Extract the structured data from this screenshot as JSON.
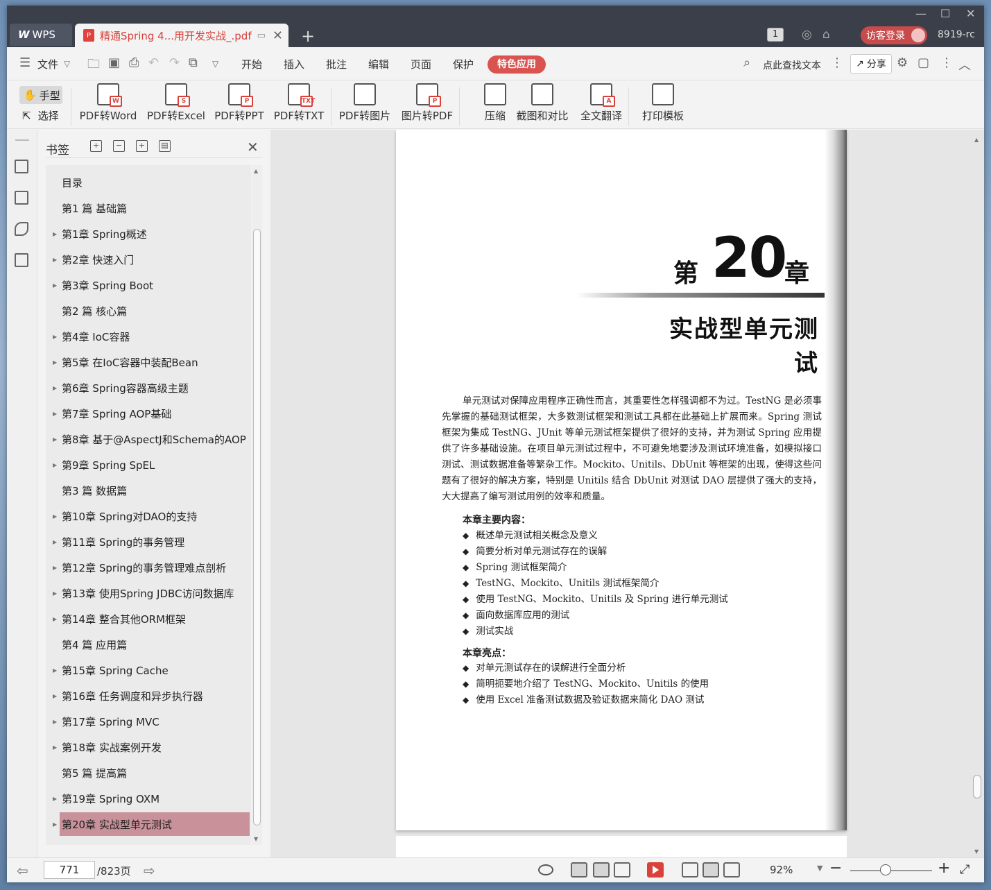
{
  "titlebar": {
    "app_tab_label": "WPS",
    "doc_tab_title": "精通Spring 4...用开发实战_.pdf",
    "window_count": "1",
    "login_label": "访客登录",
    "user_id": "8919-rc"
  },
  "menubar": {
    "file_label": "文件",
    "items": [
      "开始",
      "插入",
      "批注",
      "编辑",
      "页面",
      "保护"
    ],
    "special_label": "特色应用",
    "search_label": "点此查找文本",
    "share_label": "分享"
  },
  "ribbon": {
    "hand_label": "手型",
    "select_label": "选择",
    "buttons": [
      {
        "label": "PDF转Word",
        "mark": "W"
      },
      {
        "label": "PDF转Excel",
        "mark": "S"
      },
      {
        "label": "PDF转PPT",
        "mark": "P"
      },
      {
        "label": "PDF转TXT",
        "mark": "TXT"
      },
      {
        "label": "PDF转图片",
        "mark": ""
      },
      {
        "label": "图片转PDF",
        "mark": "P"
      },
      {
        "label": "压缩",
        "mark": ""
      },
      {
        "label": "截图和对比",
        "mark": ""
      },
      {
        "label": "全文翻译",
        "mark": "A"
      },
      {
        "label": "打印模板",
        "mark": ""
      }
    ]
  },
  "bookmarks": {
    "panel_title": "书签",
    "items": [
      {
        "label": "目录",
        "expandable": false
      },
      {
        "label": "第1 篇 基础篇",
        "expandable": false
      },
      {
        "label": "第1章 Spring概述",
        "expandable": true
      },
      {
        "label": "第2章 快速入门",
        "expandable": true
      },
      {
        "label": "第3章 Spring Boot",
        "expandable": true
      },
      {
        "label": "第2 篇 核心篇",
        "expandable": false
      },
      {
        "label": "第4章 IoC容器",
        "expandable": true
      },
      {
        "label": "第5章 在IoC容器中装配Bean",
        "expandable": true
      },
      {
        "label": "第6章 Spring容器高级主题",
        "expandable": true
      },
      {
        "label": "第7章 Spring AOP基础",
        "expandable": true
      },
      {
        "label": "第8章 基于@AspectJ和Schema的AOP",
        "expandable": true
      },
      {
        "label": "第9章 Spring SpEL",
        "expandable": true
      },
      {
        "label": "第3 篇 数据篇",
        "expandable": false
      },
      {
        "label": "第10章 Spring对DAO的支持",
        "expandable": true
      },
      {
        "label": "第11章 Spring的事务管理",
        "expandable": true
      },
      {
        "label": "第12章 Spring的事务管理难点剖析",
        "expandable": true
      },
      {
        "label": "第13章 使用Spring JDBC访问数据库",
        "expandable": true
      },
      {
        "label": "第14章 整合其他ORM框架",
        "expandable": true
      },
      {
        "label": "第4 篇 应用篇",
        "expandable": false
      },
      {
        "label": "第15章 Spring Cache",
        "expandable": true
      },
      {
        "label": "第16章 任务调度和异步执行器",
        "expandable": true
      },
      {
        "label": "第17章 Spring MVC",
        "expandable": true
      },
      {
        "label": "第18章 实战案例开发",
        "expandable": true
      },
      {
        "label": "第5 篇 提高篇",
        "expandable": false
      },
      {
        "label": "第19章 Spring OXM",
        "expandable": true
      },
      {
        "label": "第20章 实战型单元测试",
        "expandable": true,
        "selected": true
      }
    ]
  },
  "document": {
    "chapter_prefix": "第",
    "chapter_number": "20",
    "chapter_suffix": "章",
    "chapter_title": "实战型单元测试",
    "intro": "单元测试对保障应用程序正确性而言，其重要性怎样强调都不为过。TestNG 是必须事先掌握的基础测试框架，大多数测试框架和测试工具都在此基础上扩展而来。Spring 测试框架为集成 TestNG、JUnit 等单元测试框架提供了很好的支持，并为测试 Spring 应用提供了许多基础设施。在项目单元测试过程中，不可避免地要涉及测试环境准备，如模拟接口测试、测试数据准备等繁杂工作。Mockito、Unitils、DbUnit 等框架的出现，使得这些问题有了很好的解决方案，特别是 Unitils 结合 DbUnit 对测试 DAO 层提供了强大的支持，大大提高了编写测试用例的效率和质量。",
    "main_content_heading": "本章主要内容：",
    "main_content": [
      "概述单元测试相关概念及意义",
      "简要分析对单元测试存在的误解",
      "Spring 测试框架简介",
      "TestNG、Mockito、Unitils 测试框架简介",
      "使用 TestNG、Mockito、Unitils 及 Spring 进行单元测试",
      "面向数据库应用的测试",
      "测试实战"
    ],
    "highlights_heading": "本章亮点：",
    "highlights": [
      "对单元测试存在的误解进行全面分析",
      "简明扼要地介绍了 TestNG、Mockito、Unitils 的使用",
      "使用 Excel 准备测试数据及验证数据来简化 DAO 测试"
    ]
  },
  "statusbar": {
    "current_page": "771",
    "total_pages": "/823页",
    "zoom": "92%"
  },
  "colors": {
    "accent": "#d9534f",
    "selected_bookmark": "#c9919a",
    "titlebar": "#3b3f49"
  }
}
